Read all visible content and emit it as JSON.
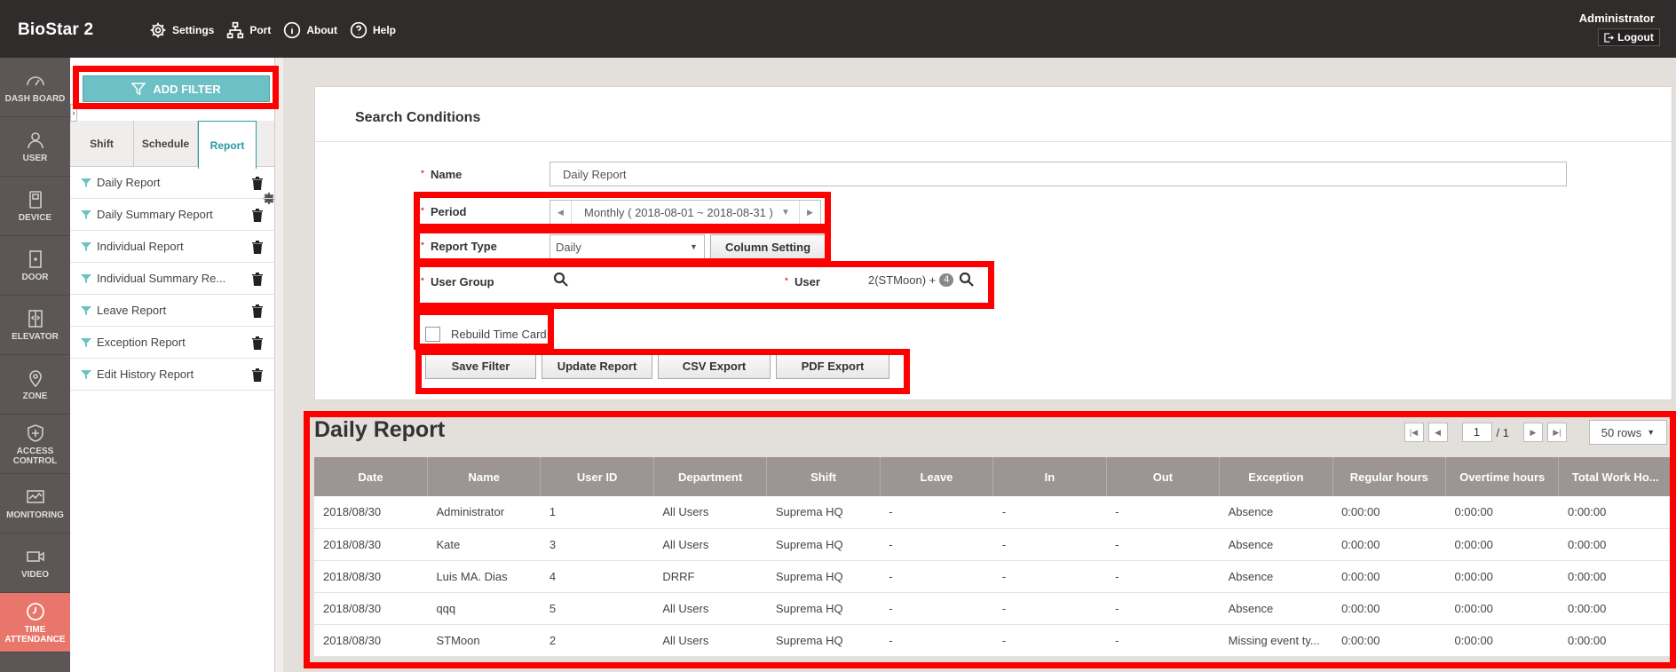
{
  "app": {
    "brand": "BioStar 2"
  },
  "topnav": {
    "settings": "Settings",
    "port": "Port",
    "about": "About",
    "help": "Help"
  },
  "user": {
    "name": "Administrator",
    "logout": "Logout"
  },
  "leftnav": [
    {
      "label": "DASH BOARD",
      "icon": "dashboard-icon"
    },
    {
      "label": "USER",
      "icon": "user-icon"
    },
    {
      "label": "DEVICE",
      "icon": "device-icon"
    },
    {
      "label": "DOOR",
      "icon": "door-icon"
    },
    {
      "label": "ELEVATOR",
      "icon": "elevator-icon"
    },
    {
      "label": "ZONE",
      "icon": "zone-icon"
    },
    {
      "label": "ACCESS CONTROL",
      "icon": "access-control-icon"
    },
    {
      "label": "MONITORING",
      "icon": "monitoring-icon"
    },
    {
      "label": "VIDEO",
      "icon": "video-icon"
    },
    {
      "label": "TIME ATTENDANCE",
      "icon": "clock-icon"
    }
  ],
  "panel": {
    "add_filter": "ADD FILTER",
    "tabs": [
      "Shift",
      "Schedule",
      "Report"
    ],
    "reports": [
      "Daily Report",
      "Daily Summary Report",
      "Individual Report",
      "Individual Summary Re...",
      "Leave Report",
      "Exception Report",
      "Edit History Report"
    ]
  },
  "search": {
    "title": "Search Conditions",
    "name_label": "Name",
    "name_value": "Daily Report",
    "period_label": "Period",
    "period_value": "Monthly ( 2018-08-01 ~ 2018-08-31 )",
    "report_type_label": "Report Type",
    "report_type_value": "Daily",
    "column_setting": "Column Setting",
    "user_group_label": "User Group",
    "user_label": "User",
    "user_value": "2(STMoon) +",
    "user_extra": "4",
    "rebuild_label": "Rebuild Time Card",
    "buttons": {
      "save": "Save Filter",
      "update": "Update Report",
      "csv": "CSV Export",
      "pdf": "PDF Export"
    }
  },
  "report": {
    "title": "Daily Report",
    "page_current": "1",
    "page_total": "/ 1",
    "rows_per_page": "50 rows",
    "columns": [
      "Date",
      "Name",
      "User ID",
      "Department",
      "Shift",
      "Leave",
      "In",
      "Out",
      "Exception",
      "Regular hours",
      "Overtime hours",
      "Total Work Ho..."
    ],
    "rows": [
      [
        "2018/08/30",
        "Administrator",
        "1",
        "All Users",
        "Suprema HQ",
        "-",
        "-",
        "-",
        "Absence",
        "0:00:00",
        "0:00:00",
        "0:00:00"
      ],
      [
        "2018/08/30",
        "Kate",
        "3",
        "All Users",
        "Suprema HQ",
        "-",
        "-",
        "-",
        "Absence",
        "0:00:00",
        "0:00:00",
        "0:00:00"
      ],
      [
        "2018/08/30",
        "Luis MA. Dias",
        "4",
        "DRRF",
        "Suprema HQ",
        "-",
        "-",
        "-",
        "Absence",
        "0:00:00",
        "0:00:00",
        "0:00:00"
      ],
      [
        "2018/08/30",
        "qqq",
        "5",
        "All Users",
        "Suprema HQ",
        "-",
        "-",
        "-",
        "Absence",
        "0:00:00",
        "0:00:00",
        "0:00:00"
      ],
      [
        "2018/08/30",
        "STMoon",
        "2",
        "All Users",
        "Suprema HQ",
        "-",
        "-",
        "-",
        "Missing event ty...",
        "0:00:00",
        "0:00:00",
        "0:00:00"
      ]
    ]
  },
  "colors": {
    "accent": "#2a9aa1",
    "highlight": "#ff0000",
    "active_nav": "#e8766a",
    "topbar": "#302c2b"
  }
}
